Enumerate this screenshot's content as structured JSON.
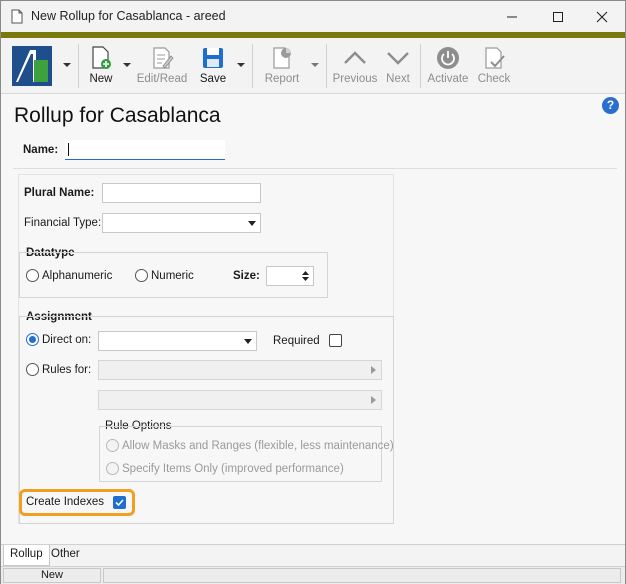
{
  "window": {
    "title": "New Rollup for Casablanca - areed",
    "minimize_icon": "minimize-icon",
    "maximize_icon": "maximize-icon",
    "close_icon": "close-icon"
  },
  "toolbar": {
    "new_label": "New",
    "editread_label": "Edit/Read",
    "save_label": "Save",
    "report_label": "Report",
    "previous_label": "Previous",
    "next_label": "Next",
    "activate_label": "Activate",
    "check_label": "Check"
  },
  "form": {
    "heading": "Rollup for Casablanca",
    "help_symbol": "?",
    "name_label": "Name:",
    "name_value": "",
    "plural_name_label": "Plural Name:",
    "plural_name_value": "",
    "financial_type_label": "Financial Type:",
    "financial_type_value": "",
    "datatype": {
      "title": "Datatype",
      "alphanumeric_label": "Alphanumeric",
      "numeric_label": "Numeric",
      "size_label": "Size:",
      "size_value": ""
    },
    "assignment": {
      "title": "Assignment",
      "direct_on_label": "Direct on:",
      "direct_on_value": "",
      "required_label": "Required",
      "rules_for_label": "Rules for:",
      "rule_options_title": "Rule Options",
      "allow_masks_label": "Allow Masks and Ranges (flexible, less maintenance)",
      "specify_items_label": "Specify Items Only (improved performance)"
    },
    "create_indexes_label": "Create Indexes",
    "create_indexes_checked": true
  },
  "tabs": [
    {
      "label": "Rollup"
    },
    {
      "label": "Other"
    }
  ],
  "status": {
    "mode": "New"
  },
  "colors": {
    "accent_strip": "#7a7a0a",
    "highlight": "#f0a020",
    "selection_blue": "#1f6fd0"
  }
}
